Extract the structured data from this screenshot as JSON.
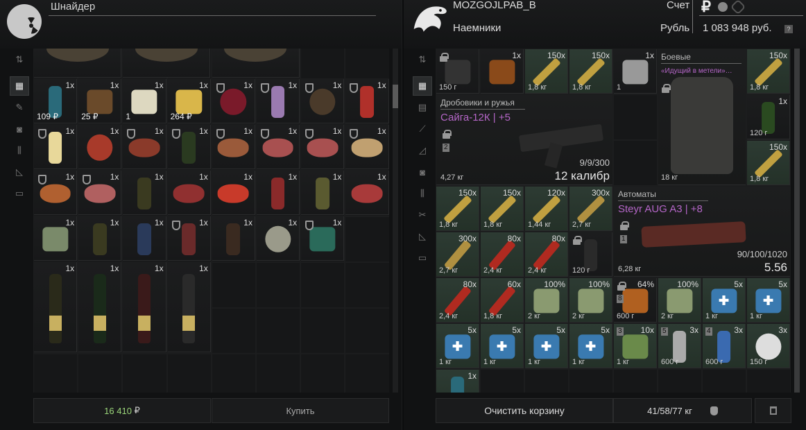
{
  "left": {
    "trader_name": "Шнайдер",
    "sidebar_icons": [
      "sort-icon",
      "grid-icon",
      "ammo-icon",
      "camera-icon",
      "bottles-icon",
      "ruler-icon",
      "box-icon"
    ],
    "items": [
      {
        "row": 1,
        "col": 0,
        "count": "1x",
        "price": "109 ₽",
        "icon": "can",
        "color": "#2a6a7a"
      },
      {
        "row": 1,
        "col": 1,
        "count": "1x",
        "price": "25 ₽",
        "icon": "bread",
        "color": "#6a4a2a"
      },
      {
        "row": 1,
        "col": 2,
        "count": "1x",
        "price": "1",
        "icon": "bread-slice",
        "color": "#ddd8c0"
      },
      {
        "row": 1,
        "col": 3,
        "count": "1x",
        "price": "264 ₽",
        "icon": "cheese",
        "color": "#d9b64a"
      },
      {
        "row": 1,
        "col": 4,
        "count": "1x",
        "icon": "berries",
        "color": "#7a1a2a",
        "shield": true
      },
      {
        "row": 1,
        "col": 5,
        "count": "1x",
        "icon": "bottle",
        "color": "#9a7ab0",
        "shield": true
      },
      {
        "row": 1,
        "col": 6,
        "count": "1x",
        "icon": "grain",
        "color": "#4a3a2a",
        "shield": true
      },
      {
        "row": 1,
        "col": 7,
        "count": "1x",
        "icon": "jar",
        "color": "#b0302a",
        "shield": true
      },
      {
        "row": 2,
        "col": 0,
        "count": "1x",
        "icon": "bottle",
        "color": "#e8d89a",
        "shield": true
      },
      {
        "row": 2,
        "col": 1,
        "count": "1x",
        "icon": "bowl",
        "color": "#a83a2a"
      },
      {
        "row": 2,
        "col": 2,
        "count": "1x",
        "icon": "meat",
        "color": "#8a3a2a",
        "shield": true
      },
      {
        "row": 2,
        "col": 3,
        "count": "1x",
        "icon": "bottle",
        "color": "#2a3a20",
        "shield": true
      },
      {
        "row": 2,
        "col": 4,
        "count": "1x",
        "icon": "leg",
        "color": "#9a5a3a",
        "shield": true
      },
      {
        "row": 2,
        "col": 5,
        "count": "1x",
        "icon": "steak",
        "color": "#a85050",
        "shield": true
      },
      {
        "row": 2,
        "col": 6,
        "count": "1x",
        "icon": "steak",
        "color": "#a85050",
        "shield": true
      },
      {
        "row": 2,
        "col": 7,
        "count": "1x",
        "icon": "fish",
        "color": "#c0a070",
        "shield": true
      },
      {
        "row": 3,
        "col": 0,
        "count": "1x",
        "icon": "chicken",
        "color": "#b06030",
        "shield": true
      },
      {
        "row": 3,
        "col": 1,
        "count": "1x",
        "icon": "steak",
        "color": "#b06060",
        "shield": true
      },
      {
        "row": 3,
        "col": 2,
        "count": "1x",
        "icon": "bottle",
        "color": "#3a3a20"
      },
      {
        "row": 3,
        "col": 3,
        "count": "1x",
        "icon": "patty",
        "color": "#903030"
      },
      {
        "row": 3,
        "col": 4,
        "count": "1x",
        "icon": "sandwich",
        "color": "#c83a2a"
      },
      {
        "row": 3,
        "col": 5,
        "count": "1x",
        "icon": "can",
        "color": "#8a2a2a"
      },
      {
        "row": 3,
        "col": 6,
        "count": "1x",
        "icon": "can",
        "color": "#5a5a30"
      },
      {
        "row": 3,
        "col": 7,
        "count": "1x",
        "icon": "sausage",
        "color": "#a83a3a"
      },
      {
        "row": 4,
        "col": 0,
        "count": "1x",
        "icon": "pack",
        "color": "#7a8a6a"
      },
      {
        "row": 4,
        "col": 1,
        "count": "1x",
        "icon": "can",
        "color": "#3a3a20"
      },
      {
        "row": 4,
        "col": 2,
        "count": "1x",
        "icon": "can",
        "color": "#2a3a5a"
      },
      {
        "row": 4,
        "col": 3,
        "count": "1x",
        "icon": "can",
        "color": "#6a2a2a",
        "shield": true
      },
      {
        "row": 4,
        "col": 4,
        "count": "1x",
        "icon": "can",
        "color": "#3a2a20"
      },
      {
        "row": 4,
        "col": 5,
        "count": "1x",
        "icon": "pan",
        "color": "#9a9a8a"
      },
      {
        "row": 4,
        "col": 6,
        "count": "1x",
        "icon": "pack",
        "color": "#2a6a5a",
        "shield": true
      },
      {
        "row": 5,
        "col": 0,
        "count": "1x",
        "icon": "fruit",
        "color": "#c05a20"
      },
      {
        "row": 5,
        "col": 1,
        "count": "1x",
        "icon": "fruit",
        "color": "#d06a30"
      },
      {
        "row": 5,
        "col": 2,
        "count": "1x",
        "icon": "fruit",
        "color": "#e0701a"
      },
      {
        "row": 5,
        "col": 3,
        "count": "1x",
        "icon": "fruit",
        "color": "#d0601a"
      }
    ],
    "bottles": [
      {
        "col": 0,
        "count": "1x",
        "color": "#2a2a1a"
      },
      {
        "col": 1,
        "count": "1x",
        "color": "#1a2a1a"
      },
      {
        "col": 2,
        "count": "1x",
        "color": "#3a1a1a"
      },
      {
        "col": 3,
        "count": "1x",
        "color": "#2a2a2a"
      }
    ],
    "total": "16 410",
    "currency": "₽",
    "buy_label": "Купить"
  },
  "right": {
    "player_name": "MOZGOJLPAB_B",
    "faction": "Наемники",
    "account_label": "Счет",
    "currency_label": "Рубль",
    "balance": "1 083 948 руб.",
    "currency_symbol": "₽",
    "sidebar_icons": [
      "sort-icon",
      "grid-icon",
      "helmet-icon",
      "rifle-icon",
      "knife-icon",
      "camera-icon",
      "bottles-icon",
      "tools-icon",
      "ruler-icon",
      "box-icon"
    ],
    "small_items": [
      {
        "x": 0,
        "y": 0,
        "count": "",
        "weight": "150 г",
        "lock": true,
        "icon": "scope",
        "color": "#333"
      },
      {
        "x": 1,
        "y": 0,
        "count": "1x",
        "weight": "",
        "icon": "patch",
        "color": "#8a4a1a"
      },
      {
        "x": 2,
        "y": 0,
        "count": "150x",
        "weight": "1,8 кг",
        "icon": "ammo",
        "color": "#c0a040",
        "green": true
      },
      {
        "x": 3,
        "y": 0,
        "count": "150x",
        "weight": "1,8 кг",
        "icon": "ammo",
        "color": "#c0a040",
        "green": true
      },
      {
        "x": 4,
        "y": 0,
        "count": "1x",
        "weight": "1",
        "icon": "plates",
        "color": "#999"
      },
      {
        "x": 0,
        "y": 3,
        "count": "150x",
        "weight": "1,8 кг",
        "icon": "ammo",
        "color": "#c0a040",
        "green": true
      },
      {
        "x": 1,
        "y": 3,
        "count": "150x",
        "weight": "1,8 кг",
        "icon": "ammo",
        "color": "#c0a040",
        "green": true
      },
      {
        "x": 2,
        "y": 3,
        "count": "120x",
        "weight": "1,44 кг",
        "icon": "ammo",
        "color": "#c0a040",
        "green": true
      },
      {
        "x": 3,
        "y": 3,
        "count": "300x",
        "weight": "2,7 кг",
        "icon": "ammo",
        "color": "#b09040",
        "green": true
      },
      {
        "x": 0,
        "y": 4,
        "count": "300x",
        "weight": "2,7 кг",
        "icon": "shell",
        "color": "#b09040",
        "green": true
      },
      {
        "x": 1,
        "y": 4,
        "count": "80x",
        "weight": "2,4 кг",
        "icon": "shell",
        "color": "#b02a20",
        "green": true
      },
      {
        "x": 2,
        "y": 4,
        "count": "80x",
        "weight": "2,4 кг",
        "icon": "shell",
        "color": "#b02a20",
        "green": true
      },
      {
        "x": 3,
        "y": 4,
        "count": "",
        "weight": "120 г",
        "lock": true,
        "icon": "suppressor",
        "color": "#2a2a2a"
      },
      {
        "x": 0,
        "y": 5,
        "count": "80x",
        "weight": "2,4 кг",
        "icon": "shell",
        "color": "#b02a20",
        "green": true
      },
      {
        "x": 1,
        "y": 5,
        "count": "60x",
        "weight": "1,8 кг",
        "icon": "shell",
        "color": "#b02a20",
        "green": true
      },
      {
        "x": 2,
        "y": 5,
        "count": "100%",
        "weight": "2 кг",
        "icon": "plate",
        "color": "#8a9a70",
        "green": true
      },
      {
        "x": 3,
        "y": 5,
        "count": "100%",
        "weight": "2 кг",
        "icon": "plate",
        "color": "#8a9a70",
        "green": true
      },
      {
        "x": 4,
        "y": 5,
        "count": "64%",
        "weight": "600 г",
        "lock": true,
        "lvl": "8",
        "icon": "device",
        "color": "#b06020"
      },
      {
        "x": 5,
        "y": 5,
        "count": "100%",
        "weight": "2 кг",
        "icon": "plate",
        "color": "#8a9a70",
        "green": true
      },
      {
        "x": 6,
        "y": 5,
        "count": "5x",
        "weight": "1 кг",
        "icon": "medkit",
        "color": "#3a7ab0",
        "green": true
      },
      {
        "x": 7,
        "y": 5,
        "count": "5x",
        "weight": "1 кг",
        "icon": "medkit",
        "color": "#3a7ab0",
        "green": true
      },
      {
        "x": 0,
        "y": 6,
        "count": "5x",
        "weight": "1 кг",
        "icon": "medkit",
        "color": "#3a7ab0",
        "green": true
      },
      {
        "x": 1,
        "y": 6,
        "count": "5x",
        "weight": "1 кг",
        "icon": "medkit",
        "color": "#3a7ab0",
        "green": true
      },
      {
        "x": 2,
        "y": 6,
        "count": "5x",
        "weight": "1 кг",
        "icon": "medkit",
        "color": "#3a7ab0",
        "green": true
      },
      {
        "x": 3,
        "y": 6,
        "count": "5x",
        "weight": "1 кг",
        "icon": "medkit",
        "color": "#3a7ab0",
        "green": true
      },
      {
        "x": 4,
        "y": 6,
        "count": "10x",
        "weight": "1 кг",
        "lvl": "3",
        "icon": "roll",
        "color": "#6a8a4a",
        "green": true
      },
      {
        "x": 5,
        "y": 6,
        "count": "3x",
        "weight": "600 г",
        "lvl": "5",
        "icon": "injector",
        "color": "#aaa",
        "green": true
      },
      {
        "x": 6,
        "y": 6,
        "count": "3x",
        "weight": "600 г",
        "lvl": "4",
        "icon": "spray",
        "color": "#3a6ab0",
        "green": true
      },
      {
        "x": 7,
        "y": 6,
        "count": "3x",
        "weight": "150 г",
        "icon": "bandage",
        "color": "#ddd",
        "green": true
      },
      {
        "x": 0,
        "y": 7,
        "count": "1x",
        "weight": "",
        "icon": "can",
        "color": "#2a6a7a",
        "green": true
      },
      {
        "x": 7,
        "y": 0,
        "count": "150x",
        "weight": "1,8 кг",
        "icon": "ammo",
        "color": "#c0a040",
        "green": true
      },
      {
        "x": 7,
        "y": 1,
        "count": "1x",
        "weight": "120 г",
        "icon": "can",
        "color": "#2a4a20"
      },
      {
        "x": 7,
        "y": 2,
        "count": "150x",
        "weight": "1,8 кг",
        "icon": "ammo",
        "color": "#c0a040",
        "green": true
      }
    ],
    "shotgun": {
      "category": "Дробовики и ружья",
      "name": "Сайга-12К | +5",
      "level": "2",
      "ammo": "9/9/300",
      "weight": "4,27 кг",
      "caliber": "12 калибр"
    },
    "rig": {
      "category": "Боевые",
      "name": "«Идущий в метели»…",
      "weight": "18 кг"
    },
    "rifle": {
      "category": "Автоматы",
      "name": "Steyr AUG A3 | +8",
      "level": "1",
      "ammo": "90/100/1020",
      "weight": "6,28 кг",
      "caliber": "5.56"
    },
    "clear_label": "Очистить корзину",
    "weight_label": "41/58/77 кг"
  }
}
